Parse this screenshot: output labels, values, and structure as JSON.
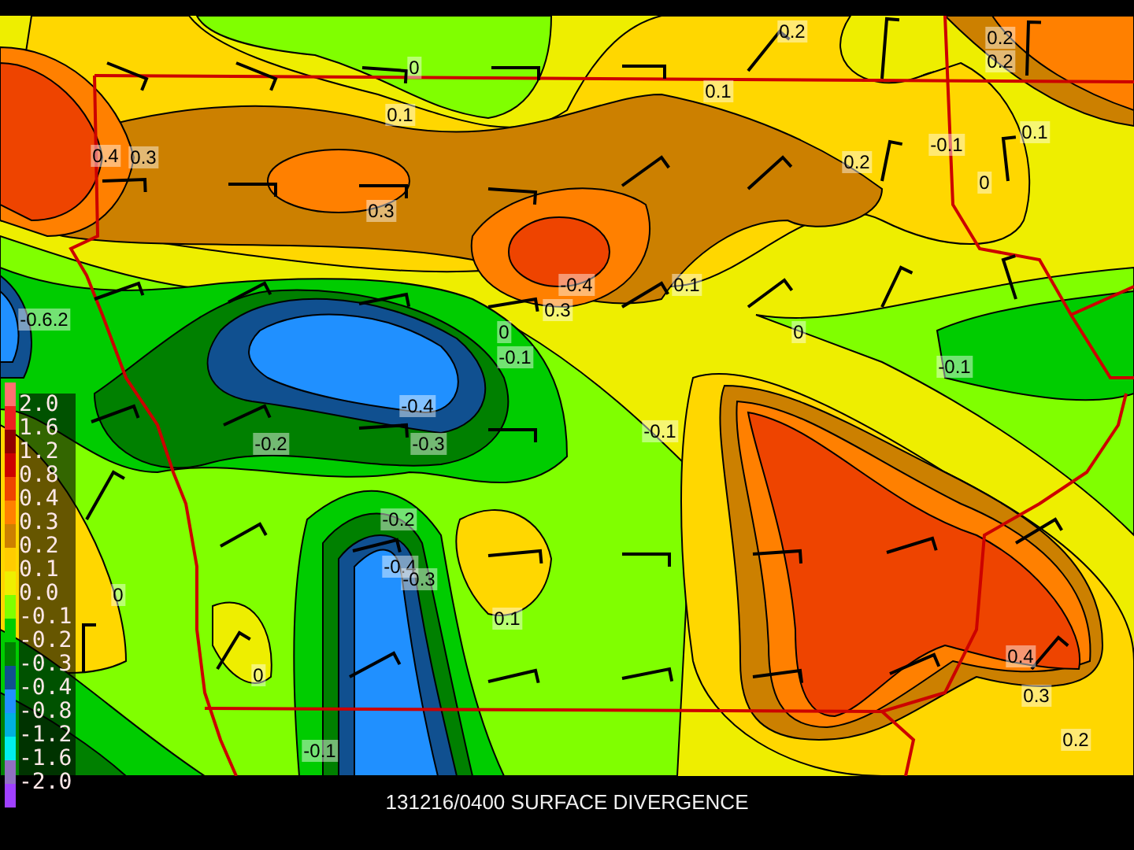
{
  "map": {
    "contour_labels": [
      "0",
      "0.1",
      "0.4",
      "0.3",
      "0.3",
      "-0.6.2",
      "0.2",
      "0.1",
      "0.2",
      "0.2",
      "-0.1",
      "0.1",
      "0.2",
      "0",
      "-0.4",
      "0.3",
      "0.1",
      "0",
      "-0.1",
      "0",
      "-0.1",
      "-0.4",
      "-0.2",
      "-0.3",
      "-0.1",
      "-0.2",
      "-0.4",
      "-0.3",
      "0",
      "0.1",
      "0",
      "-0.1",
      "0.4",
      "0.3",
      "0.2"
    ]
  },
  "legend": {
    "swatches": [
      {
        "color": "#ff7070"
      },
      {
        "color": "#ee2020"
      },
      {
        "color": "#900000"
      },
      {
        "color": "#cc0000"
      },
      {
        "color": "#ee4400"
      },
      {
        "color": "#ff8000"
      },
      {
        "color": "#cc8000"
      },
      {
        "color": "#ffcc00"
      },
      {
        "color": "#eeee00"
      },
      {
        "color": "#80ff00"
      },
      {
        "color": "#00cc00"
      },
      {
        "color": "#008000"
      },
      {
        "color": "#105090"
      },
      {
        "color": "#2090ff"
      },
      {
        "color": "#00b0e0"
      },
      {
        "color": "#00eeee"
      },
      {
        "color": "#9070c0"
      },
      {
        "color": "#a040ff"
      }
    ],
    "labels": [
      "2.0",
      "1.6",
      "1.2",
      "0.8",
      "0.4",
      "0.3",
      "0.2",
      "0.1",
      "0.0",
      "-0.1",
      "-0.2",
      "-0.3",
      "-0.4",
      "-0.8",
      "-1.2",
      "-1.6",
      "-2.0"
    ]
  },
  "title": "131216/0400 SURFACE DIVERGENCE"
}
